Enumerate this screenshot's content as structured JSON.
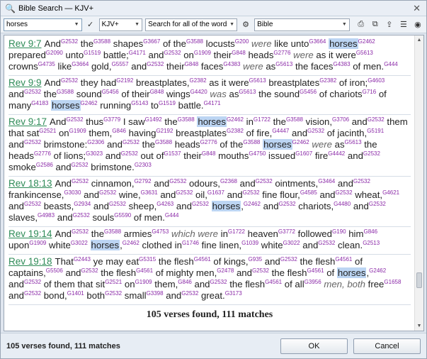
{
  "window": {
    "title": "Bible Search — KJV+",
    "close_glyph": "✕",
    "app_icon": "binoculars-icon"
  },
  "toolbar": {
    "search_value": "horses",
    "version": "KJV+",
    "search_mode": "Search for all of the words",
    "scope": "Bible"
  },
  "verses": [
    {
      "ref": "Rev 9:7",
      "html": "And<sup>G2532</sup> the<sup>G3588</sup> shapes<sup>G3667</sup> of the<sup>G3588</sup> locusts<sup>G200</sup> <em>were</em> like unto<sup>G3664</sup> <mark>horses</mark><sup>G2462</sup> prepared<sup>G2090</sup> unto<sup>G1519</sup> battle;<sup>G4171</sup> and<sup>G2532</sup> on<sup>G1909</sup> their<sup>G848</sup> heads<sup>G2776</sup> <em>were</em> as it were<sup>G5613</sup> crowns<sup>G4735</sup> like<sup>G3664</sup> gold,<sup>G5557</sup> and<sup>G2532</sup> their<sup>G848</sup> faces<sup>G4383</sup> <em>were</em> as<sup>G5613</sup> the faces<sup>G4383</sup> of men.<sup>G444</sup>"
    },
    {
      "ref": "Rev 9:9",
      "html": "And<sup>G2532</sup> they had<sup>G2192</sup> breastplates,<sup>G2382</sup> as it were<sup>G5613</sup> breastplates<sup>G2382</sup> of iron;<sup>G4603</sup> and<sup>G2532</sup> the<sup>G3588</sup> sound<sup>G5456</sup> of their<sup>G848</sup> wings<sup>G4420</sup> <em>was</em> as<sup>G5613</sup> the sound<sup>G5456</sup> of chariots<sup>G716</sup> of many<sup>G4183</sup> <mark>horses</mark><sup>G2462</sup> running<sup>G5143</sup> to<sup>G1519</sup> battle.<sup>G4171</sup>"
    },
    {
      "ref": "Rev 9:17",
      "html": "And<sup>G2532</sup> thus<sup>G3779</sup> I saw<sup>G1492</sup> the<sup>G3588</sup> <mark>horses</mark><sup>G2462</sup> in<sup>G1722</sup> the<sup>G3588</sup> vision,<sup>G3706</sup> and<sup>G2532</sup> them that sat<sup>G2521</sup> on<sup>G1909</sup> them,<sup>G846</sup> having<sup>G2192</sup> breastplates<sup>G2382</sup> of fire,<sup>G4447</sup> and<sup>G2532</sup> of jacinth,<sup>G5191</sup> and<sup>G2532</sup> brimstone:<sup>G2306</sup> and<sup>G2532</sup> the<sup>G3588</sup> heads<sup>G2776</sup> of the<sup>G3588</sup> <mark>horses</mark><sup>G2462</sup> <em>were</em> as<sup>G5613</sup> the heads<sup>G2776</sup> of lions;<sup>G3023</sup> and<sup>G2532</sup> out of<sup>G1537</sup> their<sup>G848</sup> mouths<sup>G4750</sup> issued<sup>G1607</sup> fire<sup>G4442</sup> and<sup>G2532</sup> smoke<sup>G2586</sup> and<sup>G2532</sup> brimstone.<sup>G2303</sup>"
    },
    {
      "ref": "Rev 18:13",
      "html": "And<sup>G2532</sup> cinnamon,<sup>G2792</sup> and<sup>G2532</sup> odours,<sup>G2368</sup> and<sup>G2532</sup> ointments,<sup>G3464</sup> and<sup>G2532</sup> frankincense,<sup>G3030</sup> and<sup>G2532</sup> wine,<sup>G3631</sup> and<sup>G2532</sup> oil,<sup>G1637</sup> and<sup>G2532</sup> fine flour,<sup>G4585</sup> and<sup>G2532</sup> wheat,<sup>G4621</sup> and<sup>G2532</sup> beasts,<sup>G2934</sup> and<sup>G2532</sup> sheep,<sup>G4263</sup> and<sup>G2532</sup> <mark>horses</mark>,<sup>G2462</sup> and<sup>G2532</sup> chariots,<sup>G4480</sup> and<sup>G2532</sup> slaves,<sup>G4983</sup> and<sup>G2532</sup> souls<sup>G5590</sup> of men.<sup>G444</sup>"
    },
    {
      "ref": "Rev 19:14",
      "html": "And<sup>G2532</sup> the<sup>G3588</sup> armies<sup>G4753</sup> <em>which were</em> in<sup>G1722</sup> heaven<sup>G3772</sup> followed<sup>G190</sup> him<sup>G846</sup> upon<sup>G1909</sup> white<sup>G3022</sup> <mark>horses</mark>,<sup>G2462</sup> clothed in<sup>G1746</sup> fine linen,<sup>G1039</sup> white<sup>G3022</sup> and<sup>G2532</sup> clean.<sup>G2513</sup>"
    },
    {
      "ref": "Rev 19:18",
      "html": "That<sup>G2443</sup> ye may eat<sup>G5315</sup> the flesh<sup>G4561</sup> of kings,<sup>G935</sup> and<sup>G2532</sup> the flesh<sup>G4561</sup> of captains,<sup>G5506</sup> and<sup>G2532</sup> the flesh<sup>G4561</sup> of mighty men,<sup>G2478</sup> and<sup>G2532</sup> the flesh<sup>G4561</sup> of <mark>horses</mark>,<sup>G2462</sup> and<sup>G2532</sup> of them that sit<sup>G2521</sup> on<sup>G1909</sup> them,<sup>G846</sup> and<sup>G2532</sup> the flesh<sup>G4561</sup> of all<sup>G3956</sup> <em>men, both</em> free<sup>G1658</sup> and<sup>G2532</sup> bond,<sup>G1401</sup> both<sup>G2532</sup> small<sup>G3398</sup> and<sup>G2532</sup> great.<sup>G3173</sup>"
    }
  ],
  "results_summary": "105 verses found, 111 matches",
  "status": {
    "text": "105 verses found, 111 matches"
  },
  "buttons": {
    "ok": "OK",
    "cancel": "Cancel"
  }
}
